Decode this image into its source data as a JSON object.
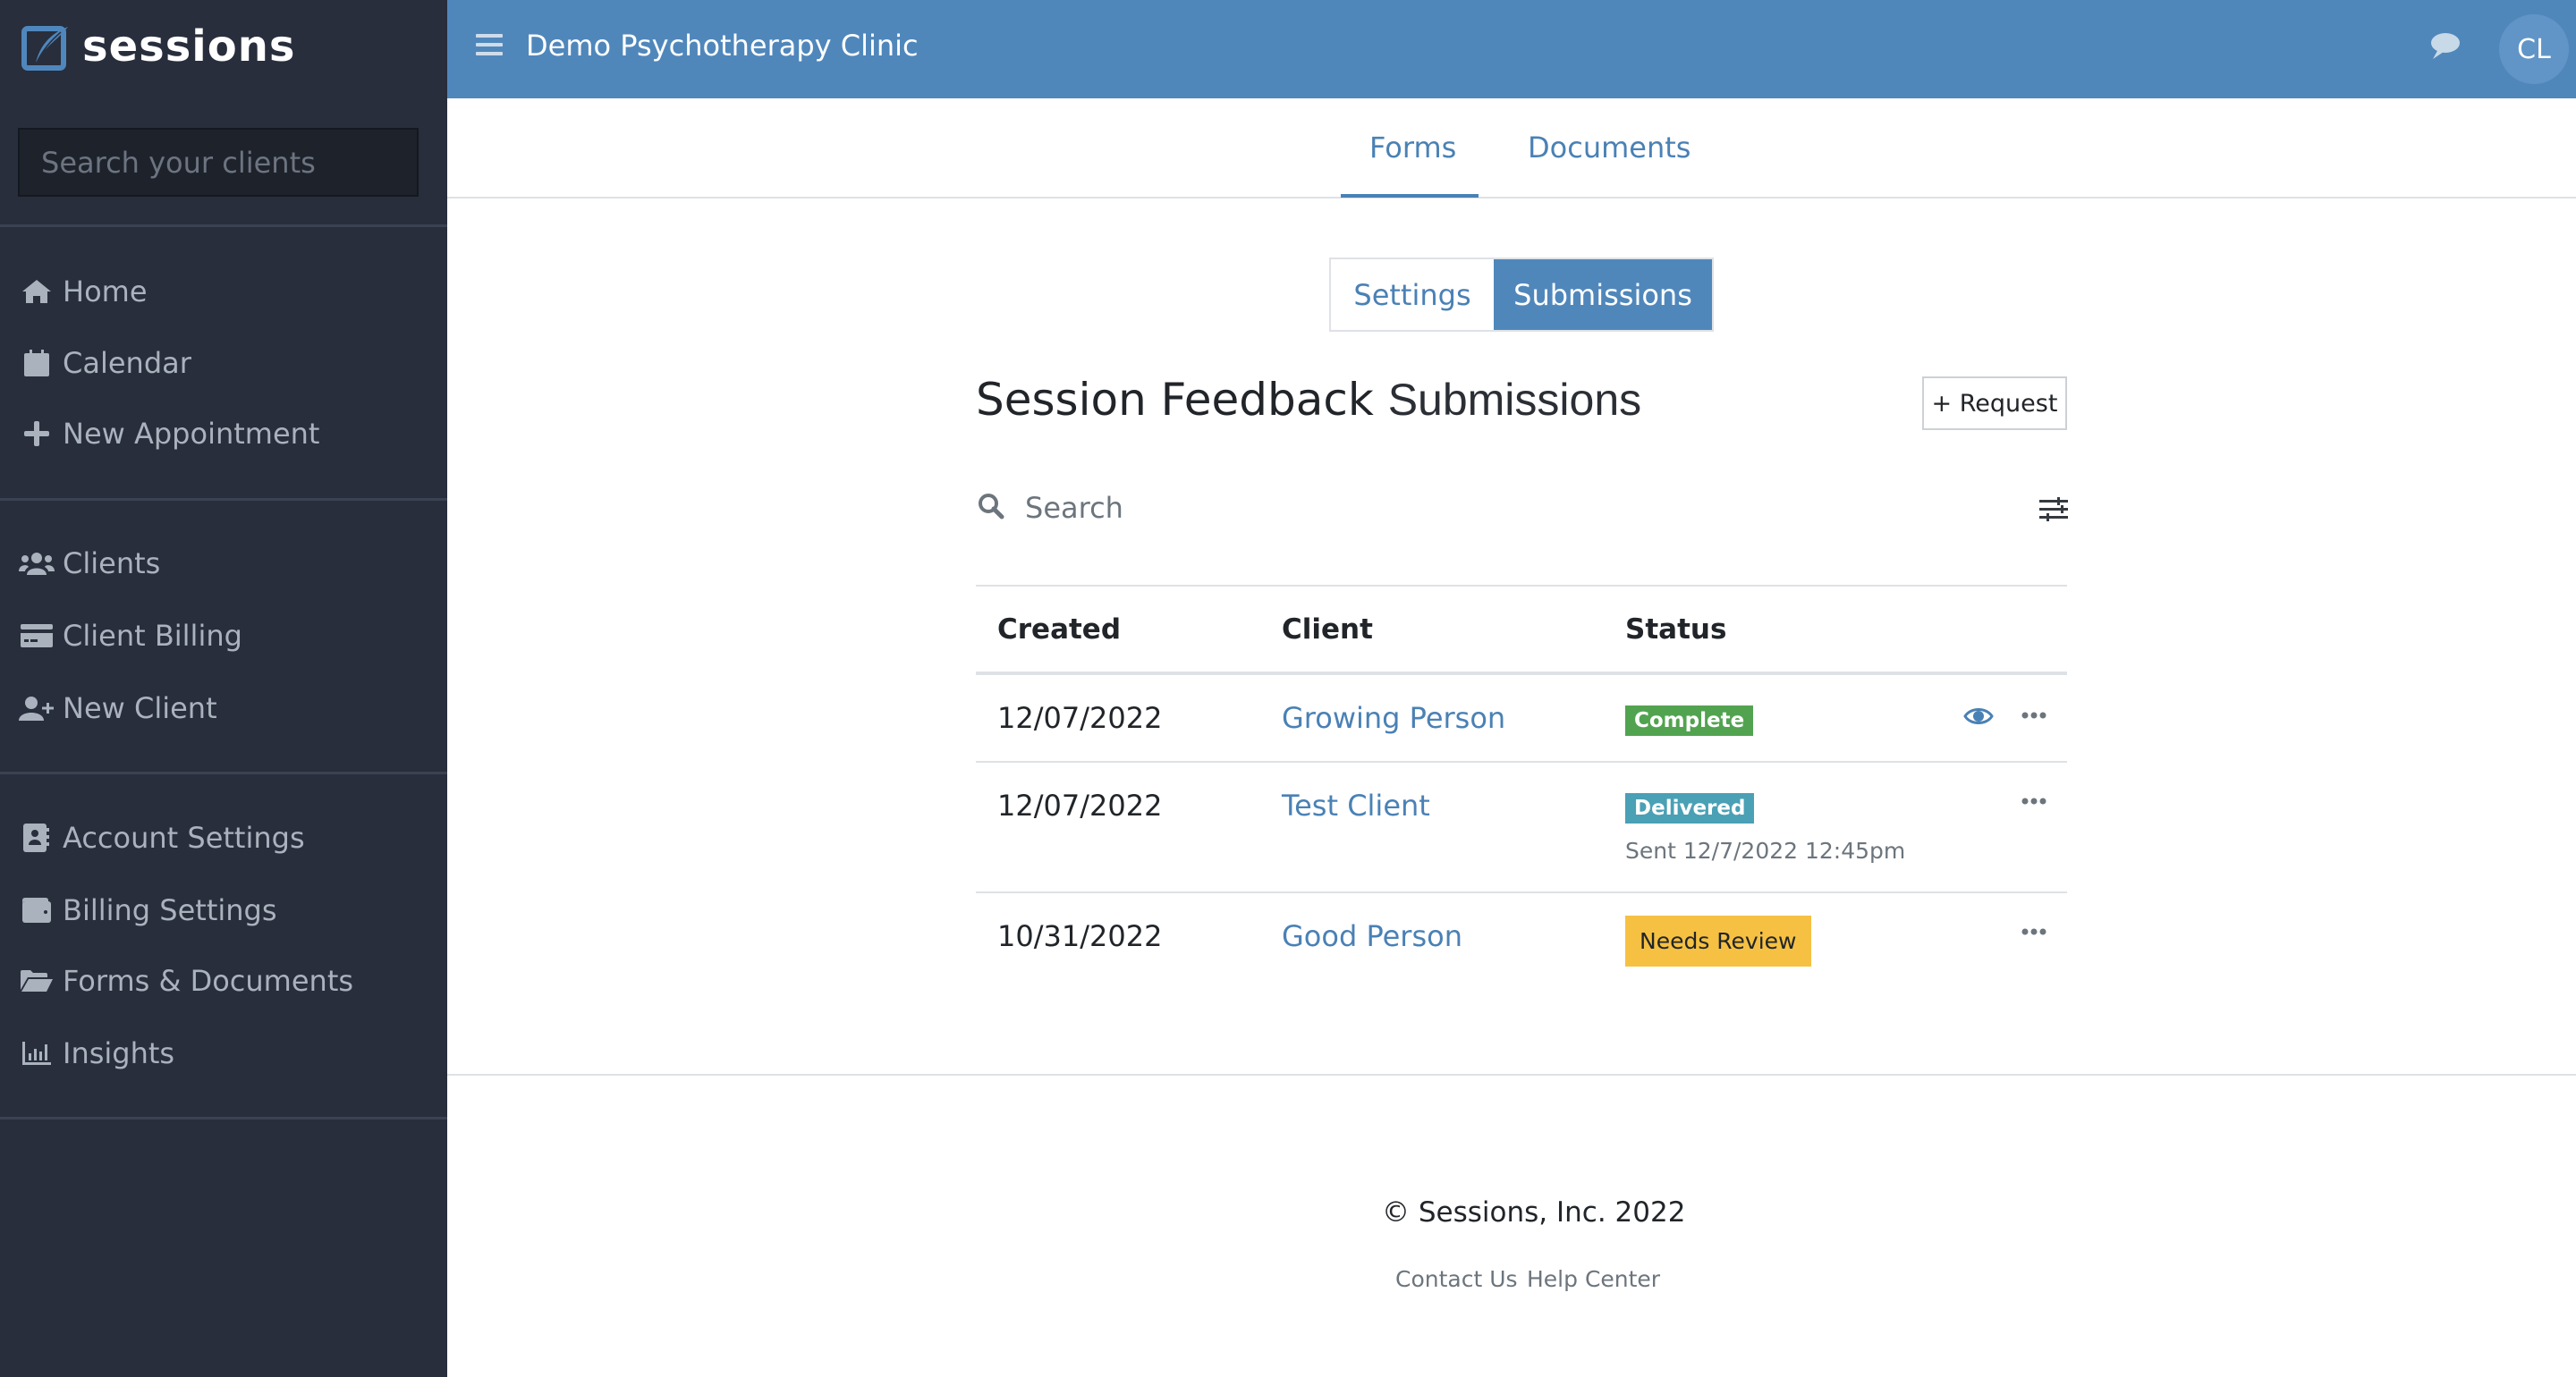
{
  "brand": {
    "name": "sessions",
    "logo_icon": "quill-checkbox-logo"
  },
  "sidebar": {
    "search_placeholder": "Search your clients",
    "groups": [
      [
        {
          "label": "Home",
          "icon": "home-icon"
        },
        {
          "label": "Calendar",
          "icon": "calendar-icon"
        },
        {
          "label": "New Appointment",
          "icon": "plus-icon"
        }
      ],
      [
        {
          "label": "Clients",
          "icon": "users-icon"
        },
        {
          "label": "Client Billing",
          "icon": "credit-card-icon"
        },
        {
          "label": "New Client",
          "icon": "user-plus-icon"
        }
      ],
      [
        {
          "label": "Account Settings",
          "icon": "address-book-icon"
        },
        {
          "label": "Billing Settings",
          "icon": "wallet-icon"
        },
        {
          "label": "Forms & Documents",
          "icon": "folder-open-icon"
        },
        {
          "label": "Insights",
          "icon": "chart-bar-icon"
        }
      ]
    ]
  },
  "header": {
    "menu_icon": "hamburger-icon",
    "title": "Demo Psychotherapy Clinic",
    "chat_icon": "comment-icon",
    "avatar_initials": "CL",
    "color": "#5087bb"
  },
  "tabs": [
    {
      "label": "Forms",
      "active": true
    },
    {
      "label": "Documents",
      "active": false
    }
  ],
  "segmented": {
    "options": [
      "Settings",
      "Submissions"
    ],
    "selected": "Submissions"
  },
  "page": {
    "title_strong": "Session Feedback",
    "title_light": "Submissions",
    "request_button": "+ Request",
    "search_placeholder": "Search"
  },
  "table": {
    "columns": [
      "Created",
      "Client",
      "Status"
    ],
    "rows": [
      {
        "created": "12/07/2022",
        "client": "Growing Person",
        "status": "Complete",
        "status_color": "#52a350",
        "note": "",
        "has_view": true
      },
      {
        "created": "12/07/2022",
        "client": "Test Client",
        "status": "Delivered",
        "status_color": "#4aa0b5",
        "note": "Sent 12/7/2022 12:45pm",
        "has_view": false
      },
      {
        "created": "10/31/2022",
        "client": "Good Person",
        "status": "Needs Review",
        "status_color": "#f6c142",
        "note": "",
        "has_view": false
      }
    ]
  },
  "footer": {
    "copyright": "© Sessions, Inc. 2022",
    "links": [
      "Contact Us",
      "Help Center"
    ]
  }
}
